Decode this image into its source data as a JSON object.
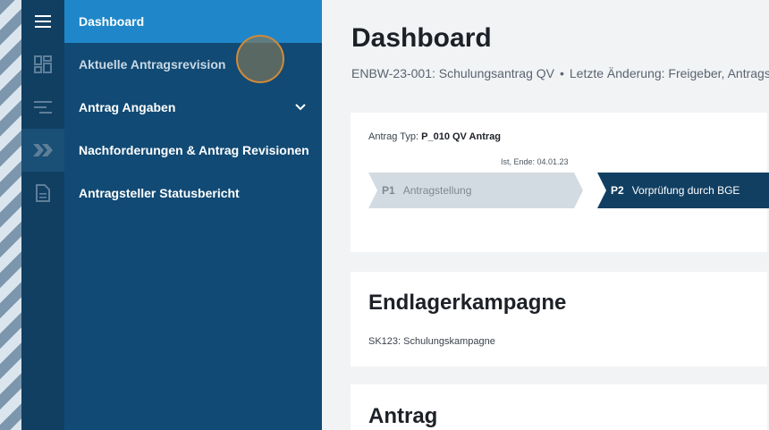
{
  "nav_rail": {
    "items": [
      {
        "icon": "hamburger-menu-icon"
      },
      {
        "icon": "dashboard-grid-icon"
      },
      {
        "icon": "list-filter-icon"
      },
      {
        "icon": "double-chevron-right-icon"
      },
      {
        "icon": "document-icon"
      }
    ]
  },
  "menu": {
    "items": [
      {
        "label": "Dashboard"
      },
      {
        "label": "Aktuelle Antragsrevision"
      },
      {
        "label": "Antrag Angaben"
      },
      {
        "label": "Nachforderungen & Antrag Revisionen"
      },
      {
        "label": "Antragsteller Statusbericht"
      }
    ]
  },
  "header": {
    "title": "Dashboard",
    "subtitle_left": "ENBW-23-001: Schulungsantrag QV",
    "separator": "•",
    "subtitle_right": "Letzte Änderung: Freigeber, Antragst"
  },
  "process_card": {
    "type_label": "Antrag Typ:",
    "type_value": "P_010 QV Antrag",
    "phase_meta": "Ist, Ende: 04.01.23",
    "phases": [
      {
        "code": "P1",
        "label": "Antragstellung"
      },
      {
        "code": "P2",
        "label": "Vorprüfung durch BGE"
      }
    ]
  },
  "campaign_card": {
    "title": "Endlagerkampagne",
    "subtitle": "SK123: Schulungskampagne"
  },
  "antrag_card": {
    "title": "Antrag"
  },
  "colors": {
    "rail": "#113f62",
    "menu": "#114a74",
    "menu_active": "#1f87c9",
    "phase_active": "#113f62",
    "phase_inactive": "#d3dbe2"
  }
}
